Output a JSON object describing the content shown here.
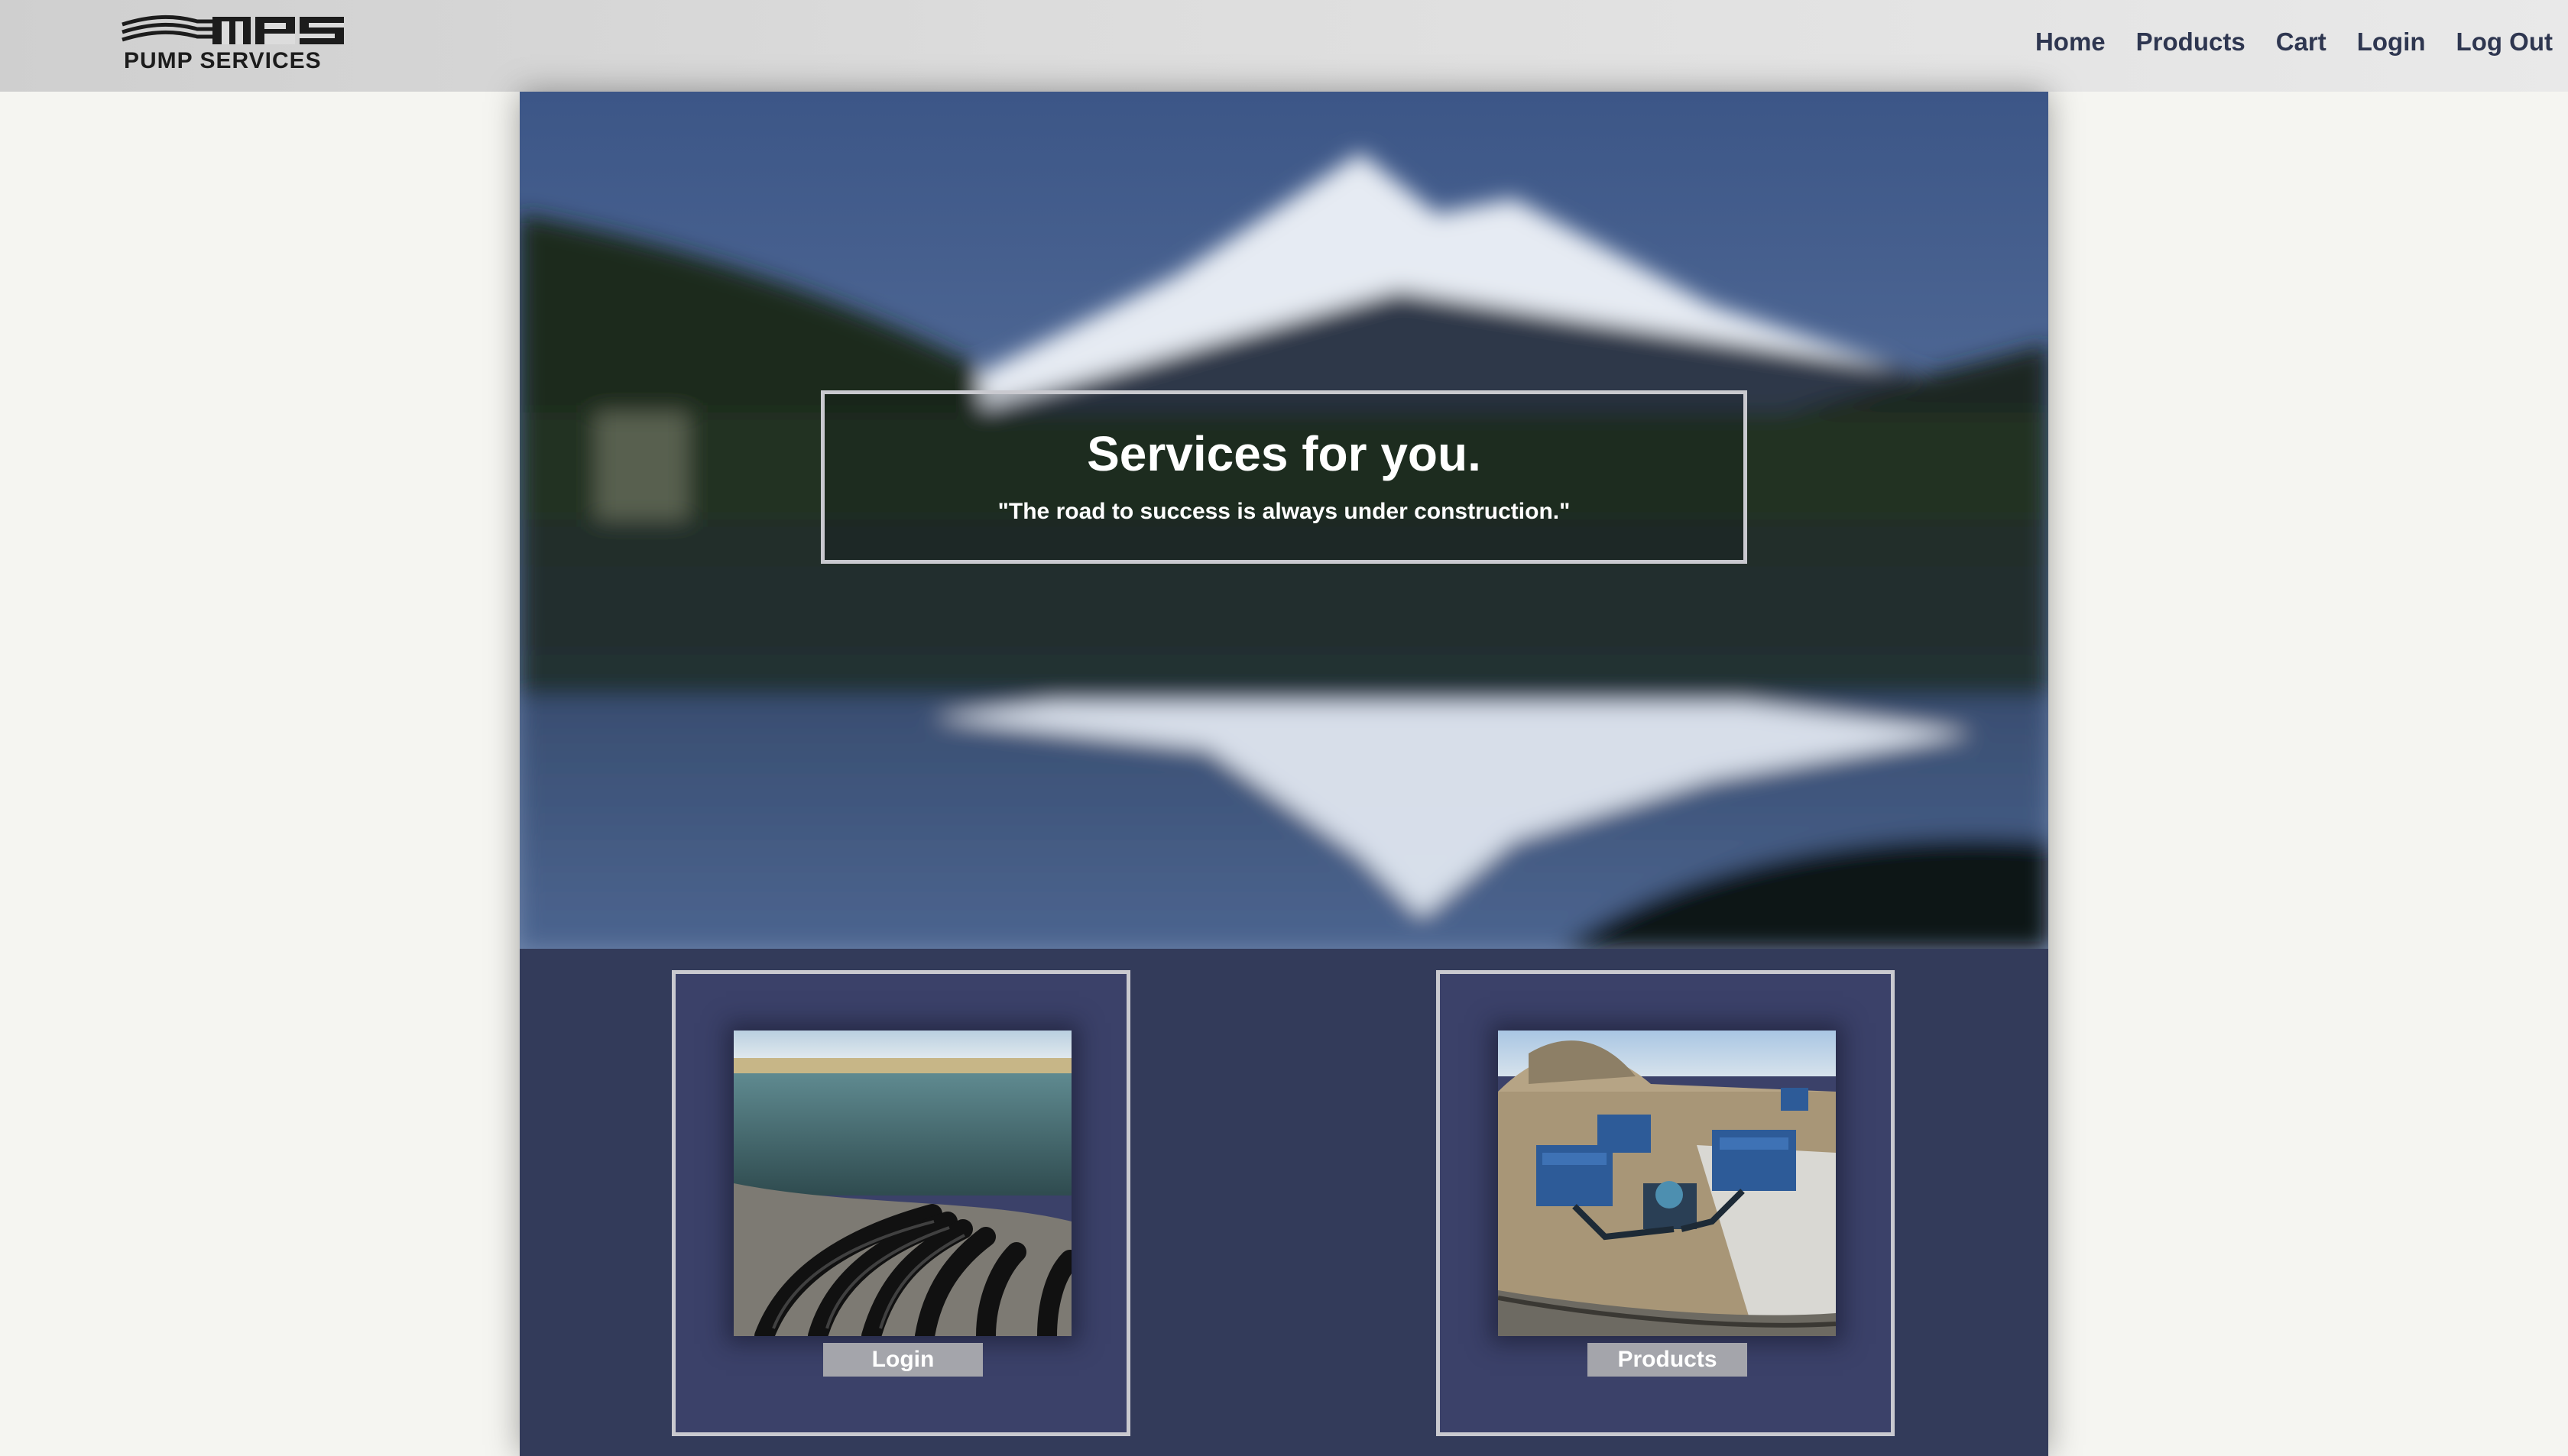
{
  "brand": {
    "logo_text": "PUMP SERVICES",
    "logo_mark": "MPS"
  },
  "nav": {
    "items": [
      {
        "label": "Home"
      },
      {
        "label": "Products"
      },
      {
        "label": "Cart"
      },
      {
        "label": "Login"
      },
      {
        "label": "Log Out"
      }
    ]
  },
  "hero": {
    "title": "Services for you.",
    "quote": "\"The road to success is always under construction.\""
  },
  "cards": [
    {
      "button_label": "Login",
      "image": "pipelines-on-lake-photo"
    },
    {
      "button_label": "Products",
      "image": "pump-units-at-site-photo"
    }
  ],
  "colors": {
    "nav_text": "#2e3650",
    "column_bg": "#333b5a",
    "card_bg": "#3b4169",
    "button_bg": "#a4a5ab",
    "frame_border": "#c9c9cf"
  }
}
